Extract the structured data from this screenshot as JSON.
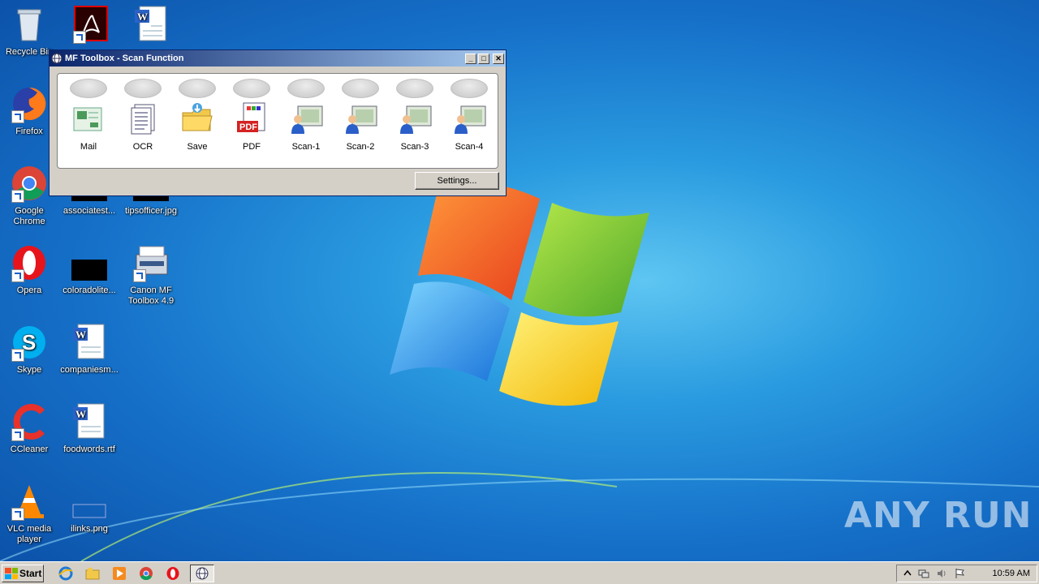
{
  "desktop": {
    "icons": [
      {
        "label": "Recycle Bin"
      },
      {
        "label": ""
      },
      {
        "label": ""
      },
      {
        "label": "Firefox"
      },
      {
        "label": "Google Chrome"
      },
      {
        "label": "associatest..."
      },
      {
        "label": "tipsofficer.jpg"
      },
      {
        "label": "Opera"
      },
      {
        "label": "coloradolite..."
      },
      {
        "label": "Canon MF Toolbox 4.9"
      },
      {
        "label": "Skype"
      },
      {
        "label": "companiesm..."
      },
      {
        "label": "CCleaner"
      },
      {
        "label": "foodwords.rtf"
      },
      {
        "label": "VLC media player"
      },
      {
        "label": "ilinks.png"
      }
    ]
  },
  "window": {
    "title": "MF Toolbox - Scan Function",
    "functions": [
      {
        "label": "Mail",
        "icon": "mail-icon"
      },
      {
        "label": "OCR",
        "icon": "ocr-document-icon"
      },
      {
        "label": "Save",
        "icon": "folder-save-icon"
      },
      {
        "label": "PDF",
        "icon": "pdf-icon"
      },
      {
        "label": "Scan-1",
        "icon": "scan-user-icon"
      },
      {
        "label": "Scan-2",
        "icon": "scan-user-icon"
      },
      {
        "label": "Scan-3",
        "icon": "scan-user-icon"
      },
      {
        "label": "Scan-4",
        "icon": "scan-user-icon"
      }
    ],
    "settings_label": "Settings..."
  },
  "taskbar": {
    "start_label": "Start",
    "clock": "10:59 AM"
  },
  "watermark": "ANY RUN"
}
